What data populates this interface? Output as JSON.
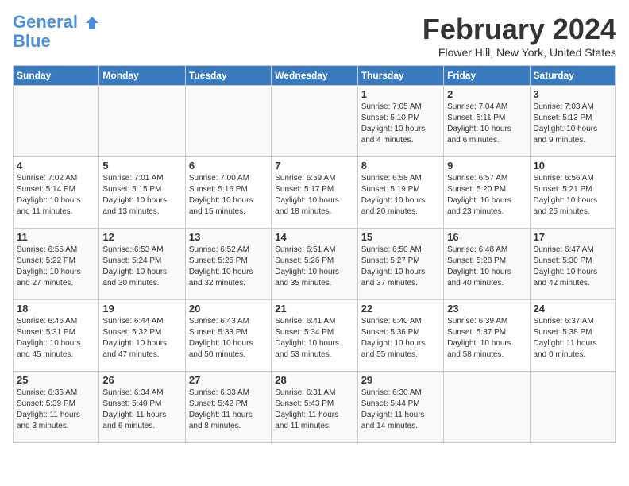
{
  "header": {
    "logo_line1": "General",
    "logo_line2": "Blue",
    "month_title": "February 2024",
    "location": "Flower Hill, New York, United States"
  },
  "weekdays": [
    "Sunday",
    "Monday",
    "Tuesday",
    "Wednesday",
    "Thursday",
    "Friday",
    "Saturday"
  ],
  "weeks": [
    [
      {
        "day": "",
        "info": ""
      },
      {
        "day": "",
        "info": ""
      },
      {
        "day": "",
        "info": ""
      },
      {
        "day": "",
        "info": ""
      },
      {
        "day": "1",
        "info": "Sunrise: 7:05 AM\nSunset: 5:10 PM\nDaylight: 10 hours\nand 4 minutes."
      },
      {
        "day": "2",
        "info": "Sunrise: 7:04 AM\nSunset: 5:11 PM\nDaylight: 10 hours\nand 6 minutes."
      },
      {
        "day": "3",
        "info": "Sunrise: 7:03 AM\nSunset: 5:13 PM\nDaylight: 10 hours\nand 9 minutes."
      }
    ],
    [
      {
        "day": "4",
        "info": "Sunrise: 7:02 AM\nSunset: 5:14 PM\nDaylight: 10 hours\nand 11 minutes."
      },
      {
        "day": "5",
        "info": "Sunrise: 7:01 AM\nSunset: 5:15 PM\nDaylight: 10 hours\nand 13 minutes."
      },
      {
        "day": "6",
        "info": "Sunrise: 7:00 AM\nSunset: 5:16 PM\nDaylight: 10 hours\nand 15 minutes."
      },
      {
        "day": "7",
        "info": "Sunrise: 6:59 AM\nSunset: 5:17 PM\nDaylight: 10 hours\nand 18 minutes."
      },
      {
        "day": "8",
        "info": "Sunrise: 6:58 AM\nSunset: 5:19 PM\nDaylight: 10 hours\nand 20 minutes."
      },
      {
        "day": "9",
        "info": "Sunrise: 6:57 AM\nSunset: 5:20 PM\nDaylight: 10 hours\nand 23 minutes."
      },
      {
        "day": "10",
        "info": "Sunrise: 6:56 AM\nSunset: 5:21 PM\nDaylight: 10 hours\nand 25 minutes."
      }
    ],
    [
      {
        "day": "11",
        "info": "Sunrise: 6:55 AM\nSunset: 5:22 PM\nDaylight: 10 hours\nand 27 minutes."
      },
      {
        "day": "12",
        "info": "Sunrise: 6:53 AM\nSunset: 5:24 PM\nDaylight: 10 hours\nand 30 minutes."
      },
      {
        "day": "13",
        "info": "Sunrise: 6:52 AM\nSunset: 5:25 PM\nDaylight: 10 hours\nand 32 minutes."
      },
      {
        "day": "14",
        "info": "Sunrise: 6:51 AM\nSunset: 5:26 PM\nDaylight: 10 hours\nand 35 minutes."
      },
      {
        "day": "15",
        "info": "Sunrise: 6:50 AM\nSunset: 5:27 PM\nDaylight: 10 hours\nand 37 minutes."
      },
      {
        "day": "16",
        "info": "Sunrise: 6:48 AM\nSunset: 5:28 PM\nDaylight: 10 hours\nand 40 minutes."
      },
      {
        "day": "17",
        "info": "Sunrise: 6:47 AM\nSunset: 5:30 PM\nDaylight: 10 hours\nand 42 minutes."
      }
    ],
    [
      {
        "day": "18",
        "info": "Sunrise: 6:46 AM\nSunset: 5:31 PM\nDaylight: 10 hours\nand 45 minutes."
      },
      {
        "day": "19",
        "info": "Sunrise: 6:44 AM\nSunset: 5:32 PM\nDaylight: 10 hours\nand 47 minutes."
      },
      {
        "day": "20",
        "info": "Sunrise: 6:43 AM\nSunset: 5:33 PM\nDaylight: 10 hours\nand 50 minutes."
      },
      {
        "day": "21",
        "info": "Sunrise: 6:41 AM\nSunset: 5:34 PM\nDaylight: 10 hours\nand 53 minutes."
      },
      {
        "day": "22",
        "info": "Sunrise: 6:40 AM\nSunset: 5:36 PM\nDaylight: 10 hours\nand 55 minutes."
      },
      {
        "day": "23",
        "info": "Sunrise: 6:39 AM\nSunset: 5:37 PM\nDaylight: 10 hours\nand 58 minutes."
      },
      {
        "day": "24",
        "info": "Sunrise: 6:37 AM\nSunset: 5:38 PM\nDaylight: 11 hours\nand 0 minutes."
      }
    ],
    [
      {
        "day": "25",
        "info": "Sunrise: 6:36 AM\nSunset: 5:39 PM\nDaylight: 11 hours\nand 3 minutes."
      },
      {
        "day": "26",
        "info": "Sunrise: 6:34 AM\nSunset: 5:40 PM\nDaylight: 11 hours\nand 6 minutes."
      },
      {
        "day": "27",
        "info": "Sunrise: 6:33 AM\nSunset: 5:42 PM\nDaylight: 11 hours\nand 8 minutes."
      },
      {
        "day": "28",
        "info": "Sunrise: 6:31 AM\nSunset: 5:43 PM\nDaylight: 11 hours\nand 11 minutes."
      },
      {
        "day": "29",
        "info": "Sunrise: 6:30 AM\nSunset: 5:44 PM\nDaylight: 11 hours\nand 14 minutes."
      },
      {
        "day": "",
        "info": ""
      },
      {
        "day": "",
        "info": ""
      }
    ]
  ]
}
